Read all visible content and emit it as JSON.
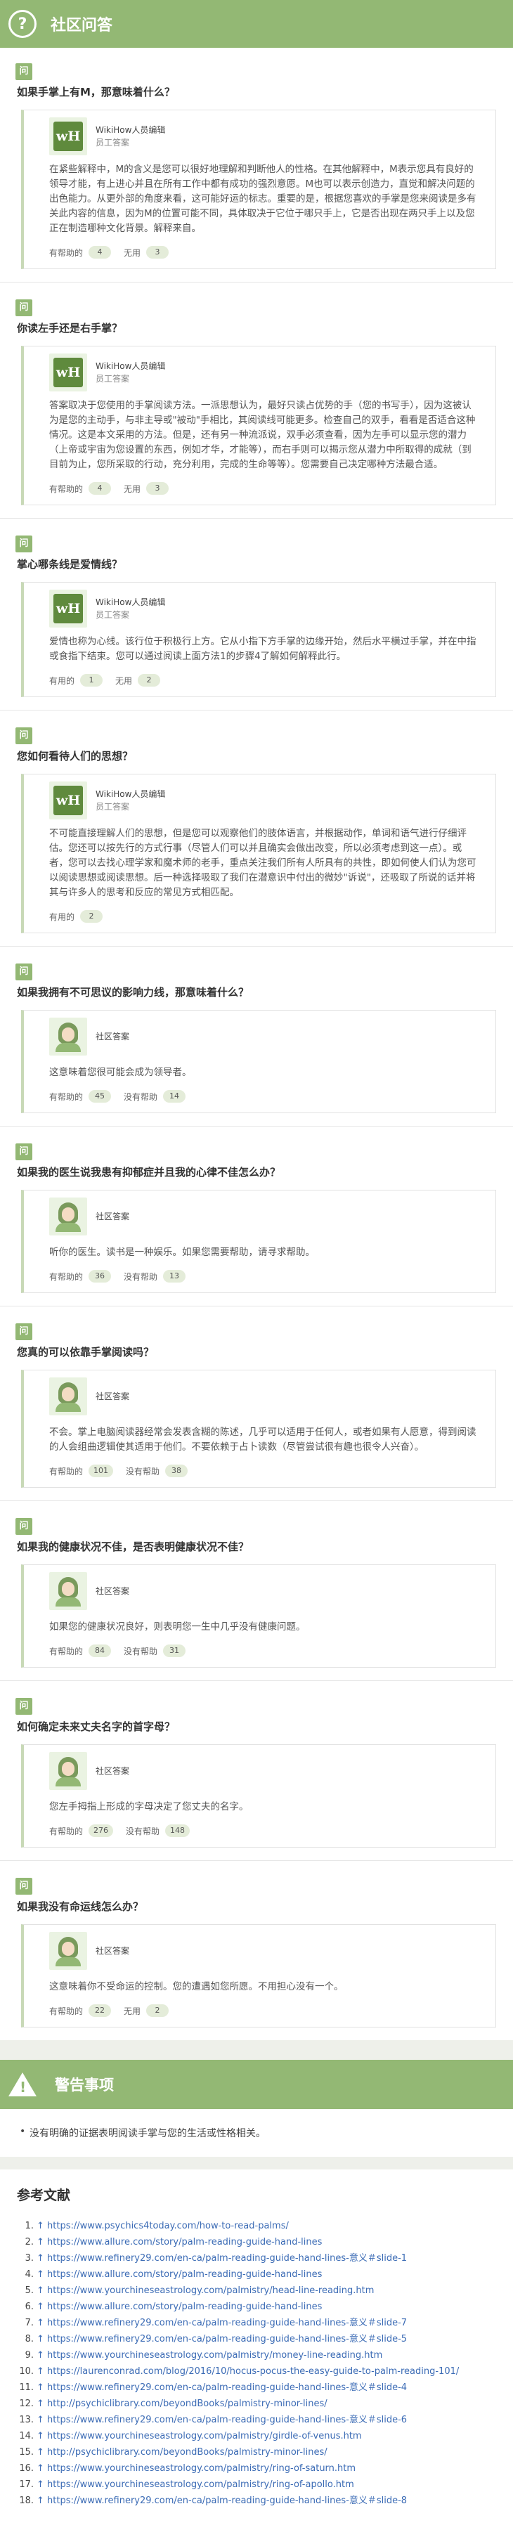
{
  "community": {
    "icon": "question-icon",
    "title": "社区问答",
    "items": [
      {
        "tag": "问",
        "question": "如果手掌上有M，那意味着什么？",
        "author": "WikiHow人员编辑",
        "role": "员工答案",
        "avatar": "wikihow-logo",
        "logo": "wH",
        "answer": "在紧些解释中，M的含义是您可以很好地理解和判断他人的性格。在其他解释中，M表示您具有良好的领导才能，有上进心并且在所有工作中都有成功的强烈意愿。M也可以表示创造力，直觉和解决问题的出色能力。从更外部的角度来看，这可能好运的标志。重要的是，根据您喜欢的手掌是您来阅读是多有关此内容的信息，因为M的位置可能不同，具体取决于它位于哪只手上，它是否出现在两只手上以及您正在制造哪种文化背景。解释来自。",
        "helpful_label": "有帮助的",
        "helpful": "4",
        "unhelpful_label": "无用",
        "unhelpful": "3"
      },
      {
        "tag": "问",
        "question": "你读左手还是右手掌？",
        "author": "WikiHow人员编辑",
        "role": "员工答案",
        "avatar": "wikihow-logo",
        "logo": "wH",
        "answer": "答案取决于您使用的手掌阅读方法。一派思想认为，最好只读占优势的手（您的书写手），因为这被认为是您的主动手，与非主导或\"被动\"手相比，其阅读线可能更多。检查自己的双手，看看是否适合这种情况。这是本文采用的方法。但是，还有另一种流派说，双手必须查看，因为左手可以显示您的潜力（上帝或宇宙为您设置的东西，例如才华，才能等），而右手则可以揭示您从潜力中所取得的成就（到目前为止，您所采取的行动，充分利用，完成的生命等等）。您需要自己决定哪种方法最合适。",
        "helpful_label": "有帮助的",
        "helpful": "4",
        "unhelpful_label": "无用",
        "unhelpful": "3"
      },
      {
        "tag": "问",
        "question": "掌心哪条线是爱情线？",
        "author": "WikiHow人员编辑",
        "role": "员工答案",
        "avatar": "wikihow-logo",
        "logo": "wH",
        "answer": "爱情也称为心线。该行位于积极行上方。它从小指下方手掌的边缘开始，然后水平横过手掌，并在中指或食指下结束。您可以通过阅读上面方法1的步骤4了解如何解释此行。",
        "helpful_label": "有用的",
        "helpful": "1",
        "unhelpful_label": "无用",
        "unhelpful": "2"
      },
      {
        "tag": "问",
        "question": "您如何看待人们的思想？",
        "author": "WikiHow人员编辑",
        "role": "员工答案",
        "avatar": "wikihow-logo",
        "logo": "wH",
        "answer": "不可能直接理解人们的思想，但是您可以观察他们的肢体语言，并根据动作，单词和语气进行仔细评估。您还可以按先行的方式行事（尽管人们可以并且确实会做出改变，所以必须考虑到这一点）。或者，您可以去找心理学家和魔术师的老手，重点关注我们所有人所具有的共性，即如何使人们认为您可以阅读思想或阅读思想。后一种选择吸取了我们在潜意识中付出的微妙\"诉说\"，还吸取了所说的话并将其与许多人的思考和反应的常见方式相匹配。",
        "helpful_label": "有用的",
        "helpful": "2",
        "unhelpful_label": "",
        "unhelpful": ""
      },
      {
        "tag": "问",
        "question": "如果我拥有不可思议的影响力线，那意味着什么？",
        "author": "社区答案",
        "role": "",
        "avatar": "person",
        "logo": "",
        "answer": "这意味着您很可能会成为领导者。",
        "helpful_label": "有帮助的",
        "helpful": "45",
        "unhelpful_label": "没有帮助",
        "unhelpful": "14"
      },
      {
        "tag": "问",
        "question": "如果我的医生说我患有抑郁症并且我的心律不佳怎么办？",
        "author": "社区答案",
        "role": "",
        "avatar": "person",
        "logo": "",
        "answer": "听你的医生。读书是一种娱乐。如果您需要帮助，请寻求帮助。",
        "helpful_label": "有帮助的",
        "helpful": "36",
        "unhelpful_label": "没有帮助",
        "unhelpful": "13"
      },
      {
        "tag": "问",
        "question": "您真的可以依靠手掌阅读吗？",
        "author": "社区答案",
        "role": "",
        "avatar": "person",
        "logo": "",
        "answer": "不会。掌上电脑阅读器经常会发表含糊的陈述，几乎可以适用于任何人，或者如果有人愿意，得到阅读的人会组曲逻辑使其适用于他们。不要依赖于占卜读数（尽管尝试很有趣也很令人兴奋）。",
        "helpful_label": "有帮助的",
        "helpful": "101",
        "unhelpful_label": "没有帮助",
        "unhelpful": "38"
      },
      {
        "tag": "问",
        "question": "如果我的健康状况不佳，是否表明健康状况不佳？",
        "author": "社区答案",
        "role": "",
        "avatar": "person",
        "logo": "",
        "answer": "如果您的健康状况良好，则表明您一生中几乎没有健康问题。",
        "helpful_label": "有帮助的",
        "helpful": "84",
        "unhelpful_label": "没有帮助",
        "unhelpful": "31"
      },
      {
        "tag": "问",
        "question": "如何确定未来丈夫名字的首字母？",
        "author": "社区答案",
        "role": "",
        "avatar": "person",
        "logo": "",
        "answer": "您左手拇指上形成的字母决定了您丈夫的名字。",
        "helpful_label": "有帮助的",
        "helpful": "276",
        "unhelpful_label": "没有帮助",
        "unhelpful": "148"
      },
      {
        "tag": "问",
        "question": "如果我没有命运线怎么办？",
        "author": "社区答案",
        "role": "",
        "avatar": "person",
        "logo": "",
        "answer": "这意味着你不受命运的控制。您的遭遇如您所愿。不用担心没有一个。",
        "helpful_label": "有帮助的",
        "helpful": "22",
        "unhelpful_label": "无用",
        "unhelpful": "2"
      }
    ]
  },
  "warnings": {
    "icon": "warning-icon",
    "title": "警告事项",
    "items": [
      "没有明确的证据表明阅读手掌与您的生活或性格相关。"
    ]
  },
  "references": {
    "title": "参考文献",
    "items": [
      {
        "num": "1.",
        "text": "↑ https://www.psychics4today.com/how-to-read-palms/"
      },
      {
        "num": "2.",
        "text": "↑ https://www.allure.com/story/palm-reading-guide-hand-lines"
      },
      {
        "num": "3.",
        "text": "↑ https://www.refinery29.com/en-ca/palm-reading-guide-hand-lines-意义＃slide-1"
      },
      {
        "num": "4.",
        "text": "↑ https://www.allure.com/story/palm-reading-guide-hand-lines"
      },
      {
        "num": "5.",
        "text": "↑ https://www.yourchineseastrology.com/palmistry/head-line-reading.htm"
      },
      {
        "num": "6.",
        "text": "↑ https://www.allure.com/story/palm-reading-guide-hand-lines"
      },
      {
        "num": "7.",
        "text": "↑ https://www.refinery29.com/en-ca/palm-reading-guide-hand-lines-意义＃slide-7"
      },
      {
        "num": "8.",
        "text": "↑ https://www.refinery29.com/en-ca/palm-reading-guide-hand-lines-意义＃slide-5"
      },
      {
        "num": "9.",
        "text": "↑ https://www.yourchineseastrology.com/palmistry/money-line-reading.htm"
      },
      {
        "num": "10.",
        "text": "↑ https://laurenconrad.com/blog/2016/10/hocus-pocus-the-easy-guide-to-palm-reading-101/"
      },
      {
        "num": "11.",
        "text": "↑ https://www.refinery29.com/en-ca/palm-reading-guide-hand-lines-意义＃slide-4"
      },
      {
        "num": "12.",
        "text": "↑ http://psychiclibrary.com/beyondBooks/palmistry-minor-lines/"
      },
      {
        "num": "13.",
        "text": "↑ https://www.refinery29.com/en-ca/palm-reading-guide-hand-lines-意义＃slide-6"
      },
      {
        "num": "14.",
        "text": "↑ https://www.yourchineseastrology.com/palmistry/girdle-of-venus.htm"
      },
      {
        "num": "15.",
        "text": "↑ http://psychiclibrary.com/beyondBooks/palmistry-minor-lines/"
      },
      {
        "num": "16.",
        "text": "↑ https://www.yourchineseastrology.com/palmistry/ring-of-saturn.htm"
      },
      {
        "num": "17.",
        "text": "↑ https://www.yourchineseastrology.com/palmistry/ring-of-apollo.htm"
      },
      {
        "num": "18.",
        "text": "↑ https://www.refinery29.com/en-ca/palm-reading-guide-hand-lines-意义＃slide-8"
      }
    ]
  }
}
